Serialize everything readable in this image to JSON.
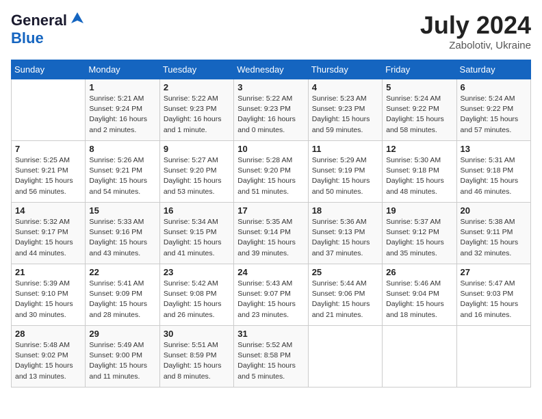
{
  "header": {
    "logo_general": "General",
    "logo_blue": "Blue",
    "month_year": "July 2024",
    "location": "Zabolotiv, Ukraine"
  },
  "columns": [
    "Sunday",
    "Monday",
    "Tuesday",
    "Wednesday",
    "Thursday",
    "Friday",
    "Saturday"
  ],
  "weeks": [
    [
      {
        "day": "",
        "info": ""
      },
      {
        "day": "1",
        "info": "Sunrise: 5:21 AM\nSunset: 9:24 PM\nDaylight: 16 hours\nand 2 minutes."
      },
      {
        "day": "2",
        "info": "Sunrise: 5:22 AM\nSunset: 9:23 PM\nDaylight: 16 hours\nand 1 minute."
      },
      {
        "day": "3",
        "info": "Sunrise: 5:22 AM\nSunset: 9:23 PM\nDaylight: 16 hours\nand 0 minutes."
      },
      {
        "day": "4",
        "info": "Sunrise: 5:23 AM\nSunset: 9:23 PM\nDaylight: 15 hours\nand 59 minutes."
      },
      {
        "day": "5",
        "info": "Sunrise: 5:24 AM\nSunset: 9:22 PM\nDaylight: 15 hours\nand 58 minutes."
      },
      {
        "day": "6",
        "info": "Sunrise: 5:24 AM\nSunset: 9:22 PM\nDaylight: 15 hours\nand 57 minutes."
      }
    ],
    [
      {
        "day": "7",
        "info": "Sunrise: 5:25 AM\nSunset: 9:21 PM\nDaylight: 15 hours\nand 56 minutes."
      },
      {
        "day": "8",
        "info": "Sunrise: 5:26 AM\nSunset: 9:21 PM\nDaylight: 15 hours\nand 54 minutes."
      },
      {
        "day": "9",
        "info": "Sunrise: 5:27 AM\nSunset: 9:20 PM\nDaylight: 15 hours\nand 53 minutes."
      },
      {
        "day": "10",
        "info": "Sunrise: 5:28 AM\nSunset: 9:20 PM\nDaylight: 15 hours\nand 51 minutes."
      },
      {
        "day": "11",
        "info": "Sunrise: 5:29 AM\nSunset: 9:19 PM\nDaylight: 15 hours\nand 50 minutes."
      },
      {
        "day": "12",
        "info": "Sunrise: 5:30 AM\nSunset: 9:18 PM\nDaylight: 15 hours\nand 48 minutes."
      },
      {
        "day": "13",
        "info": "Sunrise: 5:31 AM\nSunset: 9:18 PM\nDaylight: 15 hours\nand 46 minutes."
      }
    ],
    [
      {
        "day": "14",
        "info": "Sunrise: 5:32 AM\nSunset: 9:17 PM\nDaylight: 15 hours\nand 44 minutes."
      },
      {
        "day": "15",
        "info": "Sunrise: 5:33 AM\nSunset: 9:16 PM\nDaylight: 15 hours\nand 43 minutes."
      },
      {
        "day": "16",
        "info": "Sunrise: 5:34 AM\nSunset: 9:15 PM\nDaylight: 15 hours\nand 41 minutes."
      },
      {
        "day": "17",
        "info": "Sunrise: 5:35 AM\nSunset: 9:14 PM\nDaylight: 15 hours\nand 39 minutes."
      },
      {
        "day": "18",
        "info": "Sunrise: 5:36 AM\nSunset: 9:13 PM\nDaylight: 15 hours\nand 37 minutes."
      },
      {
        "day": "19",
        "info": "Sunrise: 5:37 AM\nSunset: 9:12 PM\nDaylight: 15 hours\nand 35 minutes."
      },
      {
        "day": "20",
        "info": "Sunrise: 5:38 AM\nSunset: 9:11 PM\nDaylight: 15 hours\nand 32 minutes."
      }
    ],
    [
      {
        "day": "21",
        "info": "Sunrise: 5:39 AM\nSunset: 9:10 PM\nDaylight: 15 hours\nand 30 minutes."
      },
      {
        "day": "22",
        "info": "Sunrise: 5:41 AM\nSunset: 9:09 PM\nDaylight: 15 hours\nand 28 minutes."
      },
      {
        "day": "23",
        "info": "Sunrise: 5:42 AM\nSunset: 9:08 PM\nDaylight: 15 hours\nand 26 minutes."
      },
      {
        "day": "24",
        "info": "Sunrise: 5:43 AM\nSunset: 9:07 PM\nDaylight: 15 hours\nand 23 minutes."
      },
      {
        "day": "25",
        "info": "Sunrise: 5:44 AM\nSunset: 9:06 PM\nDaylight: 15 hours\nand 21 minutes."
      },
      {
        "day": "26",
        "info": "Sunrise: 5:46 AM\nSunset: 9:04 PM\nDaylight: 15 hours\nand 18 minutes."
      },
      {
        "day": "27",
        "info": "Sunrise: 5:47 AM\nSunset: 9:03 PM\nDaylight: 15 hours\nand 16 minutes."
      }
    ],
    [
      {
        "day": "28",
        "info": "Sunrise: 5:48 AM\nSunset: 9:02 PM\nDaylight: 15 hours\nand 13 minutes."
      },
      {
        "day": "29",
        "info": "Sunrise: 5:49 AM\nSunset: 9:00 PM\nDaylight: 15 hours\nand 11 minutes."
      },
      {
        "day": "30",
        "info": "Sunrise: 5:51 AM\nSunset: 8:59 PM\nDaylight: 15 hours\nand 8 minutes."
      },
      {
        "day": "31",
        "info": "Sunrise: 5:52 AM\nSunset: 8:58 PM\nDaylight: 15 hours\nand 5 minutes."
      },
      {
        "day": "",
        "info": ""
      },
      {
        "day": "",
        "info": ""
      },
      {
        "day": "",
        "info": ""
      }
    ]
  ]
}
